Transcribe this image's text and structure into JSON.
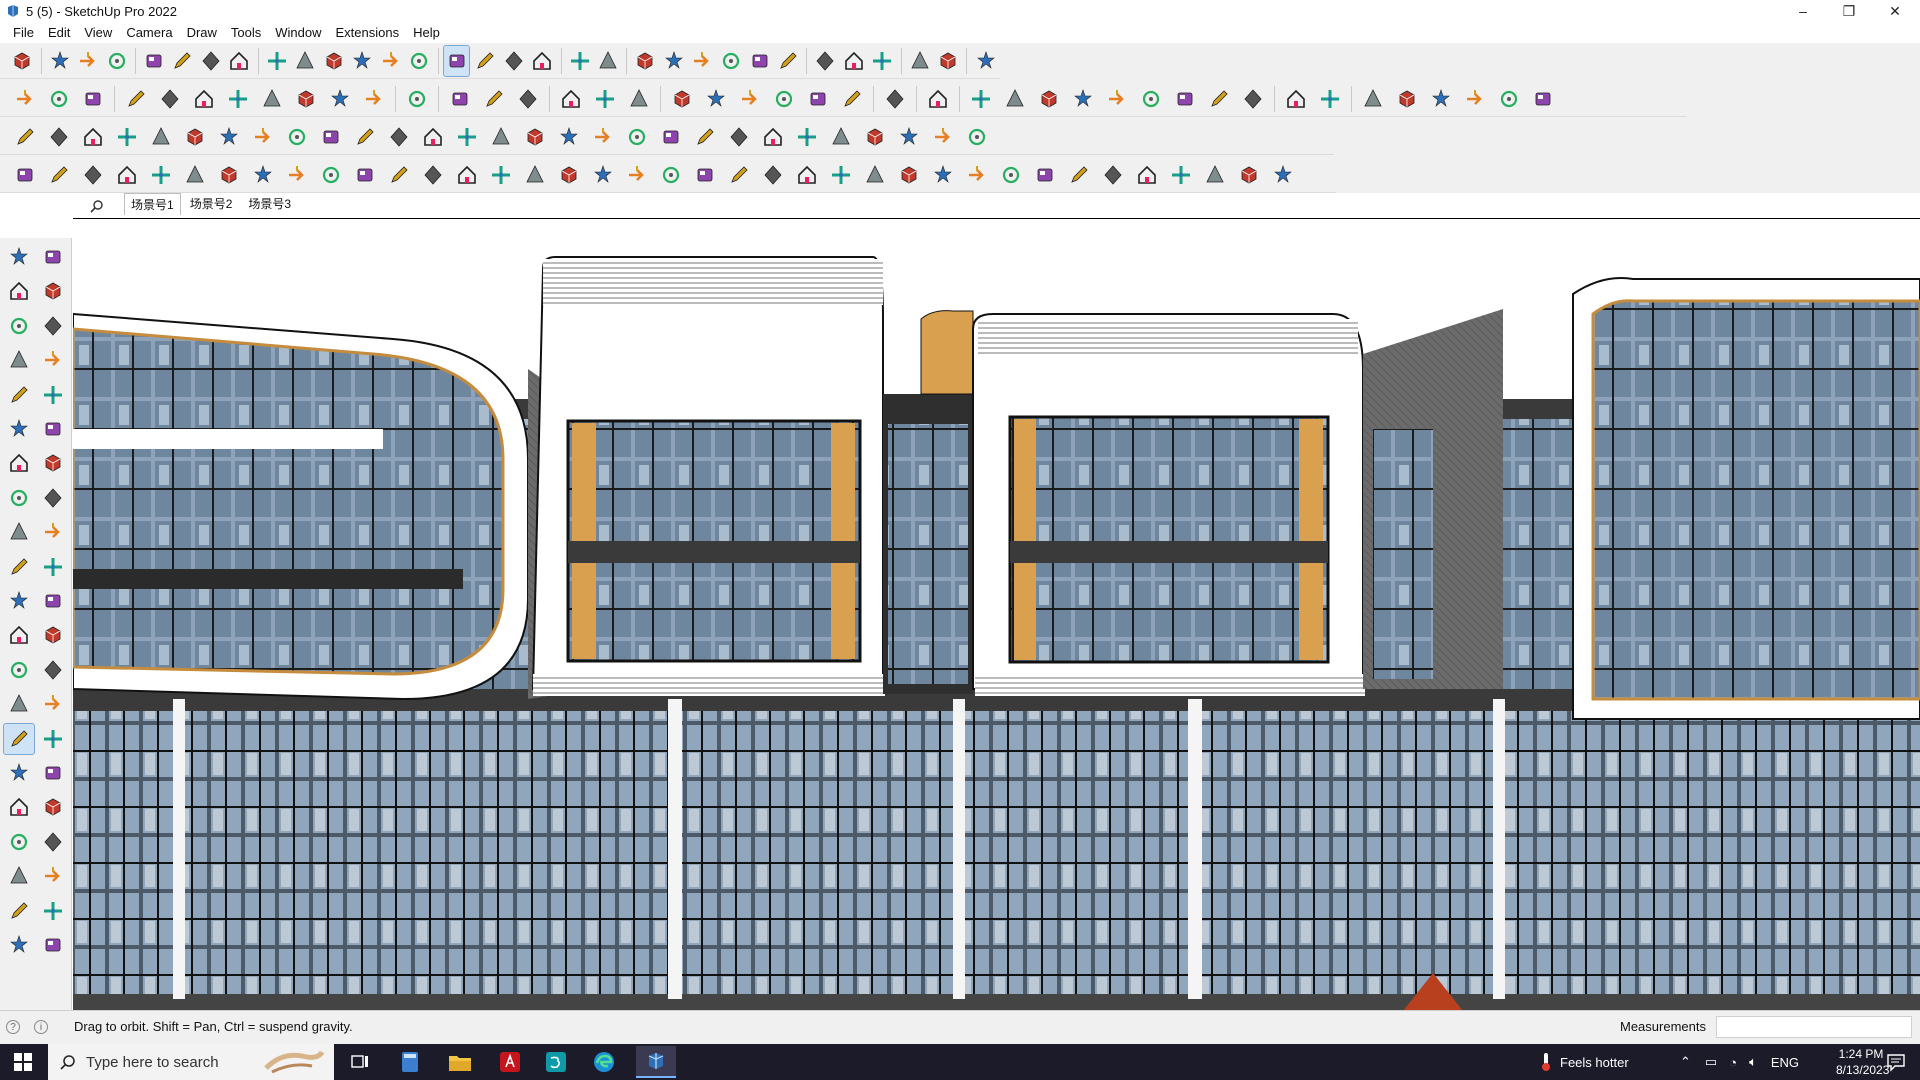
{
  "window": {
    "title": "5 (5) - SketchUp Pro 2022",
    "controls": [
      "–",
      "❐",
      "✕"
    ]
  },
  "menu": [
    "File",
    "Edit",
    "View",
    "Camera",
    "Draw",
    "Tools",
    "Window",
    "Extensions",
    "Help"
  ],
  "scenes": {
    "tabs": [
      "场景号1",
      "场景号2",
      "场景号3"
    ],
    "active": "场景号1"
  },
  "status": {
    "message": "Drag to orbit. Shift = Pan, Ctrl = suspend gravity.",
    "measurements_label": "Measurements",
    "measurements_value": ""
  },
  "taskbar": {
    "search_placeholder": "Type here to search",
    "weather": "Feels hotter",
    "language": "ENG",
    "time": "1:24 PM",
    "date": "8/13/2023",
    "apps": [
      "task-view",
      "calculator",
      "file-explorer",
      "acrobat",
      "3ds-max",
      "edge",
      "sketchup"
    ],
    "active_app": "sketchup"
  },
  "colors": {
    "accent": "#7aa7d6",
    "toolbar_bg": "#f0f0f0",
    "wood": "#d9a050",
    "glass": "#9fb4c8",
    "frame": "#2a2a2a",
    "taskbar": "#1b1b2a"
  },
  "left_tools": [
    "select-icon",
    "orbit-icon",
    "paint-bucket-icon",
    "eraser-icon",
    "component-icon",
    "tape-icon",
    "pencil-icon",
    "freehand-icon",
    "rectangle-icon",
    "rotated-rect-icon",
    "circle-icon",
    "polygon-icon",
    "arc-icon",
    "two-point-arc-icon",
    "pie-icon",
    "three-point-arc-icon",
    "move-icon",
    "push-pull-icon",
    "rotate-icon",
    "follow-me-icon",
    "scale-icon",
    "offset-icon",
    "tape-measure-icon",
    "dimension-icon",
    "protractor-icon",
    "text-icon",
    "axes-icon",
    "3d-text-icon",
    "orbit-tool-icon",
    "pan-icon",
    "zoom-icon",
    "zoom-window-icon",
    "zoom-extents-icon",
    "previous-view-icon",
    "position-camera-icon",
    "look-around-icon",
    "walk-icon",
    "section-plane-icon",
    "section-fill-icon",
    "section-cut-icon",
    "display-section-icon",
    "display-cuts-icon"
  ]
}
